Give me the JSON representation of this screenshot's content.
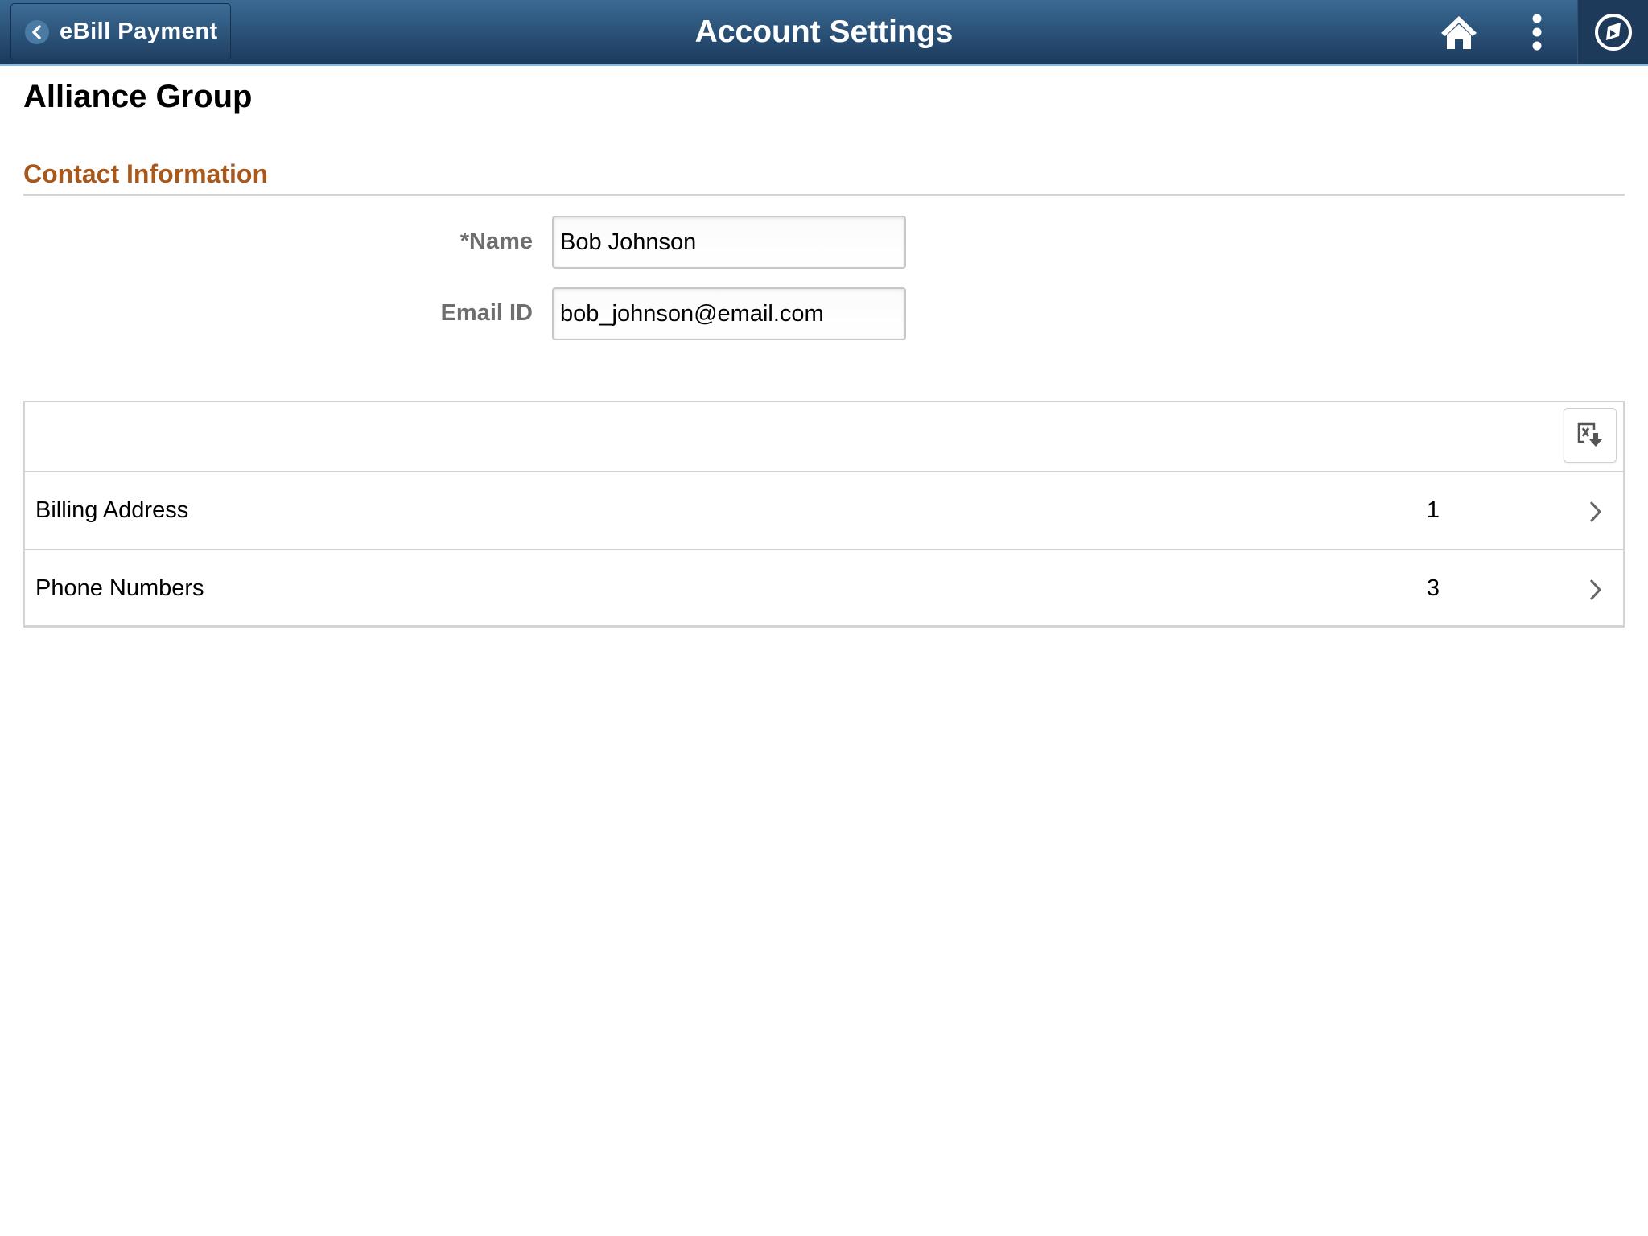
{
  "header": {
    "back_button_label": "eBill Payment",
    "title": "Account Settings",
    "icons": {
      "back": "chevron-left-icon",
      "home": "home-icon",
      "actions": "more-vertical-icon",
      "navbar": "compass-icon"
    },
    "colors": {
      "bar_top": "#3a6a93",
      "bar_bottom": "#1c3a5c",
      "accent_line": "#8cb8e0"
    }
  },
  "page": {
    "entity_title": "Alliance Group",
    "section_title": "Contact Information",
    "section_title_color": "#a9581c"
  },
  "form": {
    "name": {
      "label": "*Name",
      "value": "Bob Johnson",
      "required": true
    },
    "email": {
      "label": "Email ID",
      "value": "bob_johnson@email.com"
    }
  },
  "grid": {
    "toolbar": {
      "export_icon": "export-to-excel-icon"
    },
    "rows": [
      {
        "label": "Billing Address",
        "count": "1"
      },
      {
        "label": "Phone Numbers",
        "count": "3"
      }
    ]
  }
}
